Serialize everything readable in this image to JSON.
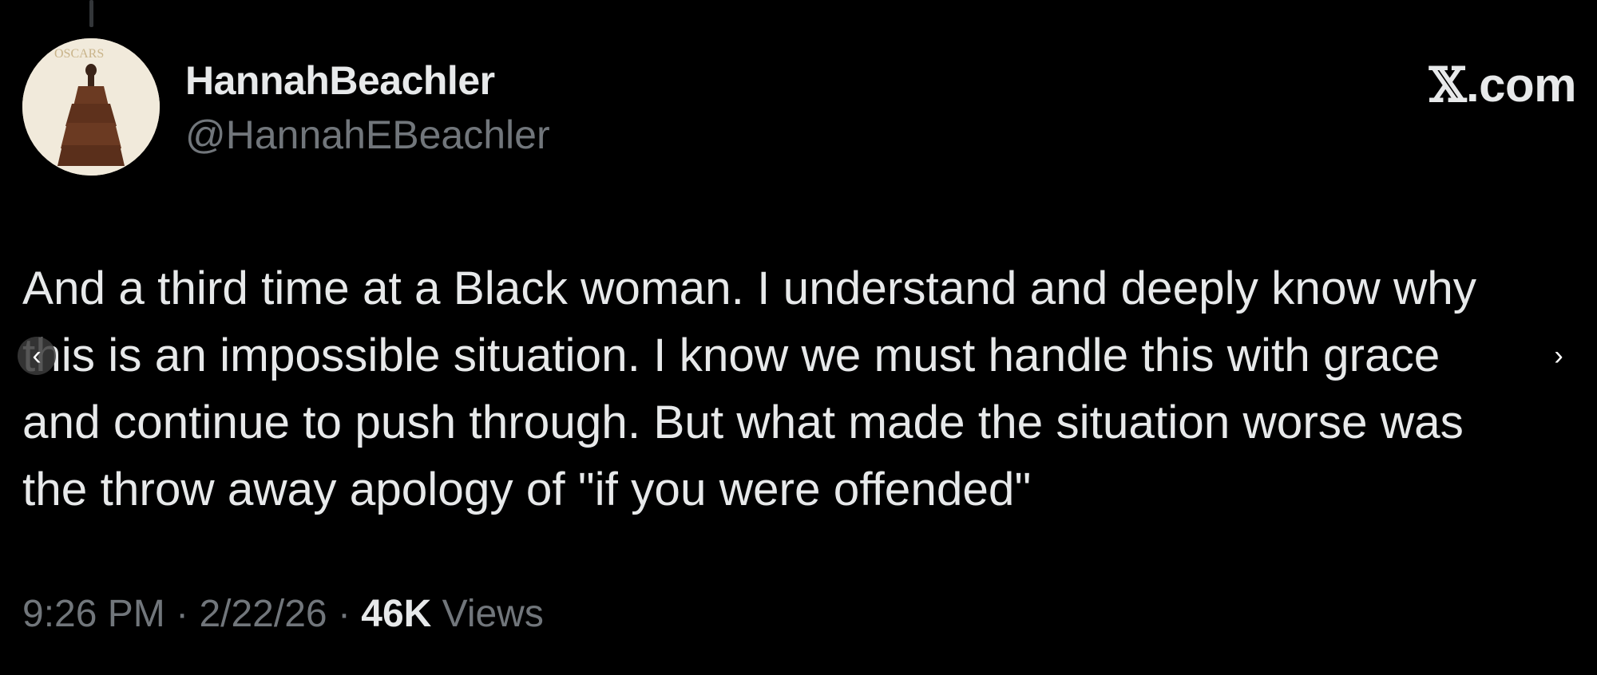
{
  "tweet": {
    "author": {
      "display_name": "HannahBeachler",
      "handle": "@HannahEBeachler",
      "avatar_text": "OSCARS"
    },
    "brand": "X.com",
    "brand_x": "𝕏",
    "brand_suffix": ".com",
    "text_lines": [
      "And a third time at a Black woman.  I understand and deeply know why",
      "this is an impossible situation.  I know we must handle this with grace",
      "and continue to push through.  But what made the situation worse was",
      "the throw away apology of \"if you were offended\""
    ],
    "time": "9:26 PM",
    "date": "2/22/26",
    "separator": "·",
    "views_count": "46K",
    "views_label": "Views"
  },
  "carousel": {
    "prev_icon": "chevron-left-icon",
    "next_icon": "chevron-right-icon",
    "prev_glyph": "‹",
    "next_glyph": "›"
  },
  "colors": {
    "background": "#000000",
    "primary_text": "#e7e9ea",
    "secondary_text": "#71767b"
  }
}
